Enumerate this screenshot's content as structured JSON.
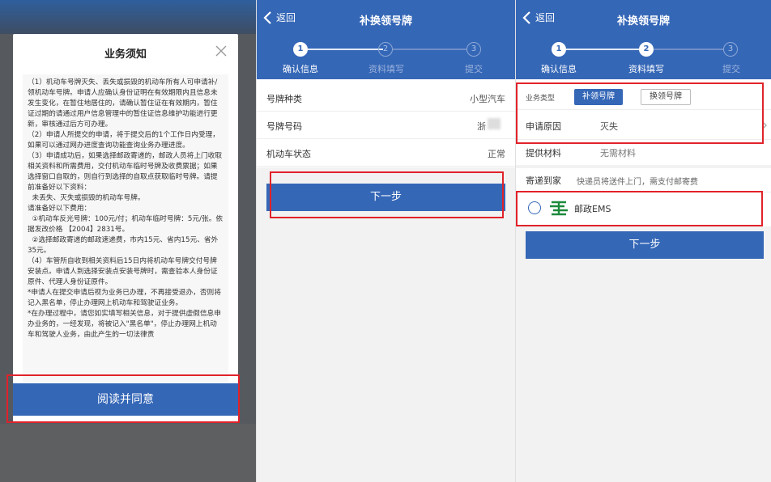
{
  "panel1": {
    "modal_title": "业务须知",
    "paragraphs": [
      "（1）机动车号牌灭失、丢失或损毁的机动车所有人可申请补/领机动车号牌。申请人应确认身份证明在有效期限内且信息未发生变化，在暂住地居住的，请确认暂住证在有效期内，暂住证过期的请通过用户信息管理中的暂住证信息维护功能进行更新，审核通过后方可办理。",
      "（2）申请人所提交的申请，将于提交后的1个工作日内受理，如果可以通过网办进度查询功能查询业务办理进度。",
      "（3）申请成功后，如果选择邮政寄递的，邮政人员将上门收取相关资料和所需费用，交付机动车临时号牌及收费票据；如果选择窗口自取的，则自行到选择的自取点获取临时号牌。请提前准备好以下资料：",
      "  未丢失、灭失或损毁的机动车号牌。",
      "请准备好以下费用：",
      "  ①机动车反光号牌：100元/付；机动车临时号牌：5元/张。依据发改价格 【2004】2831号。",
      "  ②选择邮政寄递的邮政速递费，市内15元、省内15元、省外35元。",
      "（4）车管所自收到相关资料后15日内将机动车号牌交付号牌安装点。申请人到选择安装点安装号牌时，需查验本人身份证原件、代理人身份证原件。",
      "*申请人在提交申请后视为业务已办理，不再接受退办，否则将记入黑名单，停止办理网上机动车和驾驶证业务。",
      "*在办理过程中，请您如实填写相关信息，对于提供虚假信息申办业务的，一经发现，将被记入\"黑名单\"，停止办理网上机动车和驾驶人业务，由此产生的一切法律责"
    ],
    "agree_label": "阅读并同意"
  },
  "common": {
    "back_label": "返回",
    "title": "补换领号牌",
    "steps": [
      {
        "num": "1",
        "label": "确认信息"
      },
      {
        "num": "2",
        "label": "资料填写"
      },
      {
        "num": "3",
        "label": "提交"
      }
    ],
    "next_label": "下一步"
  },
  "panel2": {
    "rows": [
      {
        "key": "号牌种类",
        "value": "小型汽车"
      },
      {
        "key": "号牌号码",
        "value": "浙"
      },
      {
        "key": "机动车状态",
        "value": "正常"
      }
    ]
  },
  "panel3": {
    "business_type_label": "业务类型",
    "option_on": "补领号牌",
    "option_off": "换领号牌",
    "reason_key": "申请原因",
    "reason_value": "灭失",
    "material_key": "提供材料",
    "material_value": "无需材料",
    "delivery_key": "寄递到家",
    "delivery_hint": "快递员将送件上门，需支付邮寄费",
    "ems_label": "邮政EMS"
  },
  "colors": {
    "brand": "#3567b7",
    "highlight": "#e1222a"
  }
}
